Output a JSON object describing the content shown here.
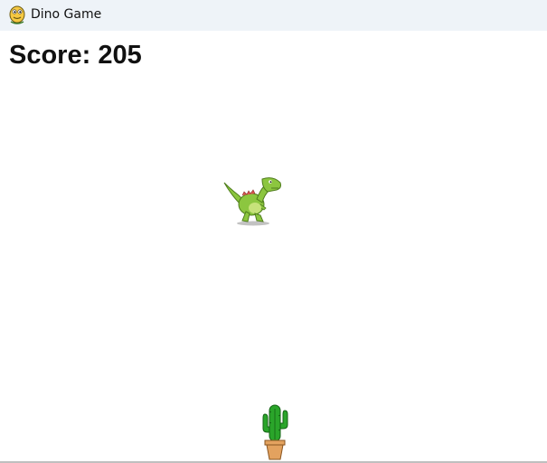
{
  "window": {
    "title": "Dino Game",
    "icon": "python-snake-icon"
  },
  "hud": {
    "score_label": "Score:",
    "score_value": "205"
  },
  "sprites": {
    "player": "dinosaur-sprite",
    "obstacle": "cactus-in-pot-sprite"
  },
  "colors": {
    "titlebar_bg": "#eef3f8",
    "dino_green": "#8cc63f",
    "cactus_green": "#2aa52a",
    "pot": "#e3a25f"
  }
}
